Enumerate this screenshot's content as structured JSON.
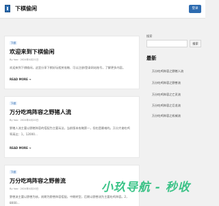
{
  "header": {
    "site_title": "下棋偷闲",
    "login_label": "登录"
  },
  "posts": [
    {
      "tag": "下棋",
      "title": "欢迎来到下棋偷闲",
      "author": "By hao",
      "date": "2024年4月21日",
      "excerpt": "欢迎来到下棋偷闲，这里分享下棋好玩相关攻略、可以注册/登录网站账号，了解更多内容。",
      "read_more": "READ MORE →"
    },
    {
      "tag": "下棋",
      "title": "万分吃鸡阵容之野猪人流",
      "author": "By hao",
      "date": "2024年4月20日",
      "excerpt": "野猪人流主要以野猪阵容的搭配为主要玩法，当前版本攻略第一，但也是最难的。万分大佬吃鸡率高达：1，12000...",
      "read_more": "READ MORE →"
    },
    {
      "tag": "下棋",
      "title": "万分吃鸡阵容之野兽流",
      "author": "By hao",
      "date": "2024年4月20日",
      "excerpt": "野兽流主要以野兽为核，前期为野兽阵容搭配，中期转型，后期以野兽流为主要吃鸡阵容。2，8000..."
    }
  ],
  "sidebar": {
    "search_label": "搜索",
    "search_button": "搜索",
    "latest_heading": "最新",
    "latest_items": [
      "万分吃鸡阵容之野猪人流",
      "万分吃鸡阵容之野兽流",
      "万分吃鸡阵容之亡灵流",
      "万分吃鸡阵容之巨龙流",
      "万分吃鸡阵容之机械流"
    ]
  },
  "watermark": "小玖导航 - 秒收"
}
